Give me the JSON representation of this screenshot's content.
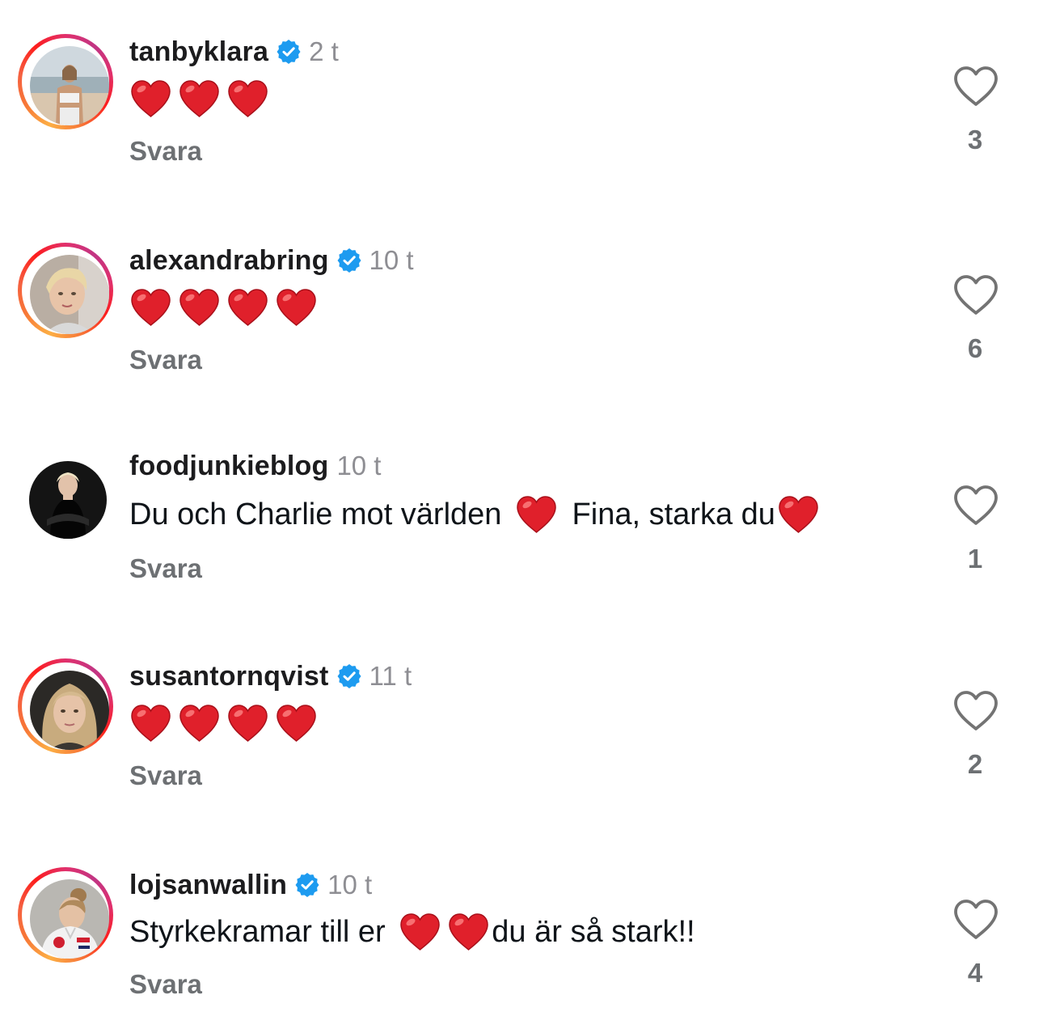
{
  "colors": {
    "verified": "#1d9bf0",
    "heart_emoji": "#e0202b",
    "secondary_text": "#8e8e93",
    "story_ring": [
      "#fcaf45",
      "#fd1d1d",
      "#c13584"
    ]
  },
  "comments": [
    {
      "username": "tanbyklara",
      "verified": true,
      "time": "2 t",
      "text": "",
      "emoji_suffix": "",
      "reply_label": "Svara",
      "likes": "3",
      "story_ring": true
    },
    {
      "username": "alexandrabring",
      "verified": true,
      "time": "10 t",
      "text": "",
      "reply_label": "Svara",
      "likes": "6",
      "story_ring": true
    },
    {
      "username": "foodjunkieblog",
      "verified": false,
      "time": "10 t",
      "text_part1": "Du och Charlie mot världen ",
      "text_part2": " Fina, starka du",
      "reply_label": "Svara",
      "likes": "1",
      "story_ring": false
    },
    {
      "username": "susantornqvist",
      "verified": true,
      "time": "11 t",
      "text": "",
      "reply_label": "Svara",
      "likes": "2",
      "story_ring": true
    },
    {
      "username": "lojsanwallin",
      "verified": true,
      "time": "10 t",
      "text_part1": "Styrkekramar till er ",
      "text_part2": "du är så stark!!",
      "reply_label": "Svara",
      "likes": "4",
      "story_ring": true
    }
  ],
  "icons": {
    "like": "heart-outline-icon",
    "verified": "verified-badge-icon",
    "emoji": "red-heart-emoji-icon"
  }
}
